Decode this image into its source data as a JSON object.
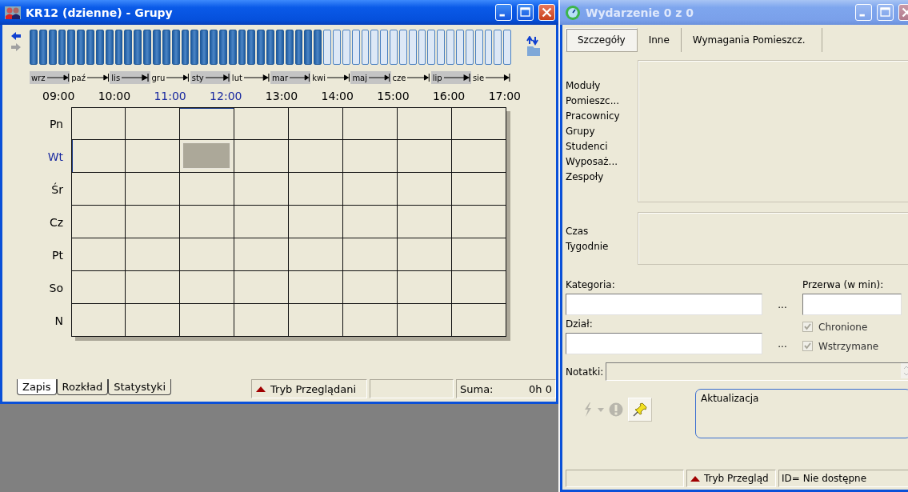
{
  "left_window": {
    "title": "KR12 (dzienne) - Grupy",
    "weeks": [
      {
        "selected": true
      },
      {
        "selected": true
      },
      {
        "selected": true
      },
      {
        "selected": true
      },
      {
        "selected": true
      },
      {
        "selected": true
      },
      {
        "selected": true
      },
      {
        "selected": true
      },
      {
        "selected": true
      },
      {
        "selected": true
      },
      {
        "selected": true
      },
      {
        "selected": true
      },
      {
        "selected": true
      },
      {
        "selected": true
      },
      {
        "selected": true
      },
      {
        "selected": true
      },
      {
        "selected": true
      },
      {
        "selected": true
      },
      {
        "selected": true
      },
      {
        "selected": true
      },
      {
        "selected": true
      },
      {
        "selected": true
      },
      {
        "selected": true
      },
      {
        "selected": true
      },
      {
        "selected": true
      },
      {
        "selected": true
      },
      {
        "selected": true
      },
      {
        "selected": true
      },
      {
        "selected": true
      },
      {
        "selected": true
      },
      {
        "selected": true
      },
      {
        "selected": false
      },
      {
        "selected": false
      },
      {
        "selected": false
      },
      {
        "selected": false
      },
      {
        "selected": false
      },
      {
        "selected": false
      },
      {
        "selected": false
      },
      {
        "selected": false
      },
      {
        "selected": false
      },
      {
        "selected": false
      },
      {
        "selected": false
      },
      {
        "selected": false
      },
      {
        "selected": false
      },
      {
        "selected": false
      },
      {
        "selected": false
      },
      {
        "selected": false
      },
      {
        "selected": false
      },
      {
        "selected": false
      },
      {
        "selected": false
      },
      {
        "selected": false
      }
    ],
    "months": [
      {
        "label": "wrz",
        "shaded": true
      },
      {
        "label": "paź",
        "shaded": false
      },
      {
        "label": "lis",
        "shaded": true
      },
      {
        "label": "gru",
        "shaded": false
      },
      {
        "label": "sty",
        "shaded": true
      },
      {
        "label": "lut",
        "shaded": false
      },
      {
        "label": "mar",
        "shaded": true
      },
      {
        "label": "kwi",
        "shaded": false
      },
      {
        "label": "maj",
        "shaded": true
      },
      {
        "label": "cze",
        "shaded": false
      },
      {
        "label": "lip",
        "shaded": true
      },
      {
        "label": "sie",
        "shaded": false
      }
    ],
    "hours": [
      {
        "label": "09:00",
        "selected": false
      },
      {
        "label": "10:00",
        "selected": false
      },
      {
        "label": "11:00",
        "selected": true
      },
      {
        "label": "12:00",
        "selected": true
      },
      {
        "label": "13:00",
        "selected": false
      },
      {
        "label": "14:00",
        "selected": false
      },
      {
        "label": "15:00",
        "selected": false
      },
      {
        "label": "16:00",
        "selected": false
      },
      {
        "label": "17:00",
        "selected": false
      }
    ],
    "days": [
      {
        "label": "Pn",
        "selected": false,
        "slots": [
          false,
          false,
          false,
          false,
          false,
          false,
          false,
          false
        ]
      },
      {
        "label": "Wt",
        "selected": true,
        "slots": [
          false,
          false,
          true,
          false,
          false,
          false,
          false,
          false
        ]
      },
      {
        "label": "Śr",
        "selected": false,
        "slots": [
          false,
          false,
          false,
          false,
          false,
          false,
          false,
          false
        ]
      },
      {
        "label": "Cz",
        "selected": false,
        "slots": [
          false,
          false,
          false,
          false,
          false,
          false,
          false,
          false
        ]
      },
      {
        "label": "Pt",
        "selected": false,
        "slots": [
          false,
          false,
          false,
          false,
          false,
          false,
          false,
          false
        ]
      },
      {
        "label": "So",
        "selected": false,
        "slots": [
          false,
          false,
          false,
          false,
          false,
          false,
          false,
          false
        ]
      },
      {
        "label": "N",
        "selected": false,
        "slots": [
          false,
          false,
          false,
          false,
          false,
          false,
          false,
          false
        ]
      }
    ],
    "tabs": [
      {
        "label": "Zapis",
        "selected": true
      },
      {
        "label": "Rozkład",
        "selected": false
      },
      {
        "label": "Statystyki",
        "selected": false
      }
    ],
    "status_bar": {
      "mode": "Tryb Przeglądani",
      "sum_label": "Suma:",
      "sum_value": "0h 0"
    }
  },
  "right_window": {
    "title": "Wydarzenie 0 z 0",
    "tabs": [
      {
        "label": "Szczegóły",
        "selected": true
      },
      {
        "label": "Inne",
        "selected": false
      },
      {
        "label": "Wymagania Pomieszcz.",
        "selected": false
      }
    ],
    "resource_labels": [
      "Moduły",
      "Pomieszc...",
      "Pracownicy",
      "Grupy",
      "Studenci",
      "Wyposaż...",
      "Zespoły"
    ],
    "time_labels": [
      "Czas",
      "Tygodnie"
    ],
    "category": {
      "label": "Kategoria:",
      "browse": "..."
    },
    "break": {
      "label": "Przerwa (w min):"
    },
    "department": {
      "label": "Dział:",
      "browse": "..."
    },
    "checkboxes": [
      {
        "label": "Chronione",
        "checked": true,
        "disabled": true
      },
      {
        "label": "Wstrzymane",
        "checked": true,
        "disabled": true
      }
    ],
    "notes": {
      "label": "Notatki:"
    },
    "pin_pressed": true,
    "update_text": "Aktualizacja",
    "status_bar": {
      "mode": "Tryb Przegląd",
      "id": "ID= Nie dostępne"
    }
  }
}
